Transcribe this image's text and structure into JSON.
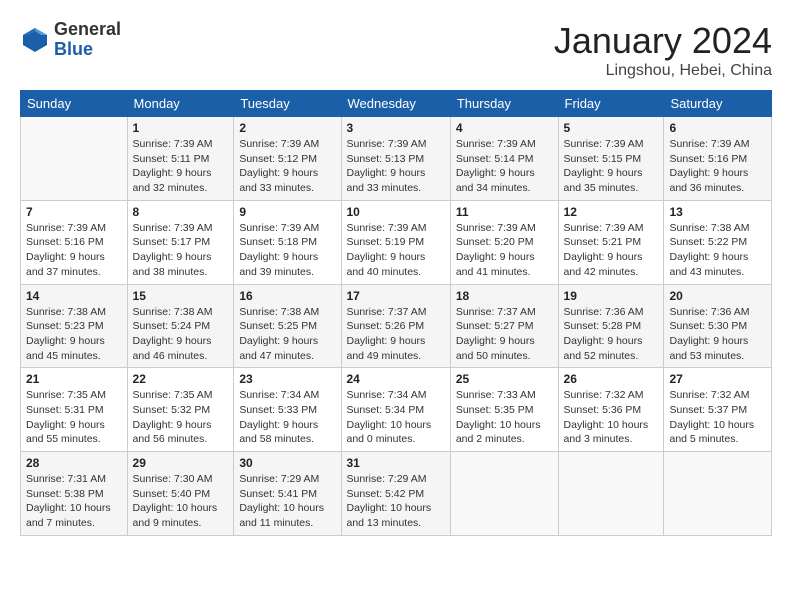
{
  "header": {
    "logo_general": "General",
    "logo_blue": "Blue",
    "month_title": "January 2024",
    "location": "Lingshou, Hebei, China"
  },
  "columns": [
    "Sunday",
    "Monday",
    "Tuesday",
    "Wednesday",
    "Thursday",
    "Friday",
    "Saturday"
  ],
  "weeks": [
    [
      {
        "day": "",
        "sunrise": "",
        "sunset": "",
        "daylight": ""
      },
      {
        "day": "1",
        "sunrise": "Sunrise: 7:39 AM",
        "sunset": "Sunset: 5:11 PM",
        "daylight": "Daylight: 9 hours and 32 minutes."
      },
      {
        "day": "2",
        "sunrise": "Sunrise: 7:39 AM",
        "sunset": "Sunset: 5:12 PM",
        "daylight": "Daylight: 9 hours and 33 minutes."
      },
      {
        "day": "3",
        "sunrise": "Sunrise: 7:39 AM",
        "sunset": "Sunset: 5:13 PM",
        "daylight": "Daylight: 9 hours and 33 minutes."
      },
      {
        "day": "4",
        "sunrise": "Sunrise: 7:39 AM",
        "sunset": "Sunset: 5:14 PM",
        "daylight": "Daylight: 9 hours and 34 minutes."
      },
      {
        "day": "5",
        "sunrise": "Sunrise: 7:39 AM",
        "sunset": "Sunset: 5:15 PM",
        "daylight": "Daylight: 9 hours and 35 minutes."
      },
      {
        "day": "6",
        "sunrise": "Sunrise: 7:39 AM",
        "sunset": "Sunset: 5:16 PM",
        "daylight": "Daylight: 9 hours and 36 minutes."
      }
    ],
    [
      {
        "day": "7",
        "sunrise": "Sunrise: 7:39 AM",
        "sunset": "Sunset: 5:16 PM",
        "daylight": "Daylight: 9 hours and 37 minutes."
      },
      {
        "day": "8",
        "sunrise": "Sunrise: 7:39 AM",
        "sunset": "Sunset: 5:17 PM",
        "daylight": "Daylight: 9 hours and 38 minutes."
      },
      {
        "day": "9",
        "sunrise": "Sunrise: 7:39 AM",
        "sunset": "Sunset: 5:18 PM",
        "daylight": "Daylight: 9 hours and 39 minutes."
      },
      {
        "day": "10",
        "sunrise": "Sunrise: 7:39 AM",
        "sunset": "Sunset: 5:19 PM",
        "daylight": "Daylight: 9 hours and 40 minutes."
      },
      {
        "day": "11",
        "sunrise": "Sunrise: 7:39 AM",
        "sunset": "Sunset: 5:20 PM",
        "daylight": "Daylight: 9 hours and 41 minutes."
      },
      {
        "day": "12",
        "sunrise": "Sunrise: 7:39 AM",
        "sunset": "Sunset: 5:21 PM",
        "daylight": "Daylight: 9 hours and 42 minutes."
      },
      {
        "day": "13",
        "sunrise": "Sunrise: 7:38 AM",
        "sunset": "Sunset: 5:22 PM",
        "daylight": "Daylight: 9 hours and 43 minutes."
      }
    ],
    [
      {
        "day": "14",
        "sunrise": "Sunrise: 7:38 AM",
        "sunset": "Sunset: 5:23 PM",
        "daylight": "Daylight: 9 hours and 45 minutes."
      },
      {
        "day": "15",
        "sunrise": "Sunrise: 7:38 AM",
        "sunset": "Sunset: 5:24 PM",
        "daylight": "Daylight: 9 hours and 46 minutes."
      },
      {
        "day": "16",
        "sunrise": "Sunrise: 7:38 AM",
        "sunset": "Sunset: 5:25 PM",
        "daylight": "Daylight: 9 hours and 47 minutes."
      },
      {
        "day": "17",
        "sunrise": "Sunrise: 7:37 AM",
        "sunset": "Sunset: 5:26 PM",
        "daylight": "Daylight: 9 hours and 49 minutes."
      },
      {
        "day": "18",
        "sunrise": "Sunrise: 7:37 AM",
        "sunset": "Sunset: 5:27 PM",
        "daylight": "Daylight: 9 hours and 50 minutes."
      },
      {
        "day": "19",
        "sunrise": "Sunrise: 7:36 AM",
        "sunset": "Sunset: 5:28 PM",
        "daylight": "Daylight: 9 hours and 52 minutes."
      },
      {
        "day": "20",
        "sunrise": "Sunrise: 7:36 AM",
        "sunset": "Sunset: 5:30 PM",
        "daylight": "Daylight: 9 hours and 53 minutes."
      }
    ],
    [
      {
        "day": "21",
        "sunrise": "Sunrise: 7:35 AM",
        "sunset": "Sunset: 5:31 PM",
        "daylight": "Daylight: 9 hours and 55 minutes."
      },
      {
        "day": "22",
        "sunrise": "Sunrise: 7:35 AM",
        "sunset": "Sunset: 5:32 PM",
        "daylight": "Daylight: 9 hours and 56 minutes."
      },
      {
        "day": "23",
        "sunrise": "Sunrise: 7:34 AM",
        "sunset": "Sunset: 5:33 PM",
        "daylight": "Daylight: 9 hours and 58 minutes."
      },
      {
        "day": "24",
        "sunrise": "Sunrise: 7:34 AM",
        "sunset": "Sunset: 5:34 PM",
        "daylight": "Daylight: 10 hours and 0 minutes."
      },
      {
        "day": "25",
        "sunrise": "Sunrise: 7:33 AM",
        "sunset": "Sunset: 5:35 PM",
        "daylight": "Daylight: 10 hours and 2 minutes."
      },
      {
        "day": "26",
        "sunrise": "Sunrise: 7:32 AM",
        "sunset": "Sunset: 5:36 PM",
        "daylight": "Daylight: 10 hours and 3 minutes."
      },
      {
        "day": "27",
        "sunrise": "Sunrise: 7:32 AM",
        "sunset": "Sunset: 5:37 PM",
        "daylight": "Daylight: 10 hours and 5 minutes."
      }
    ],
    [
      {
        "day": "28",
        "sunrise": "Sunrise: 7:31 AM",
        "sunset": "Sunset: 5:38 PM",
        "daylight": "Daylight: 10 hours and 7 minutes."
      },
      {
        "day": "29",
        "sunrise": "Sunrise: 7:30 AM",
        "sunset": "Sunset: 5:40 PM",
        "daylight": "Daylight: 10 hours and 9 minutes."
      },
      {
        "day": "30",
        "sunrise": "Sunrise: 7:29 AM",
        "sunset": "Sunset: 5:41 PM",
        "daylight": "Daylight: 10 hours and 11 minutes."
      },
      {
        "day": "31",
        "sunrise": "Sunrise: 7:29 AM",
        "sunset": "Sunset: 5:42 PM",
        "daylight": "Daylight: 10 hours and 13 minutes."
      },
      {
        "day": "",
        "sunrise": "",
        "sunset": "",
        "daylight": ""
      },
      {
        "day": "",
        "sunrise": "",
        "sunset": "",
        "daylight": ""
      },
      {
        "day": "",
        "sunrise": "",
        "sunset": "",
        "daylight": ""
      }
    ]
  ]
}
